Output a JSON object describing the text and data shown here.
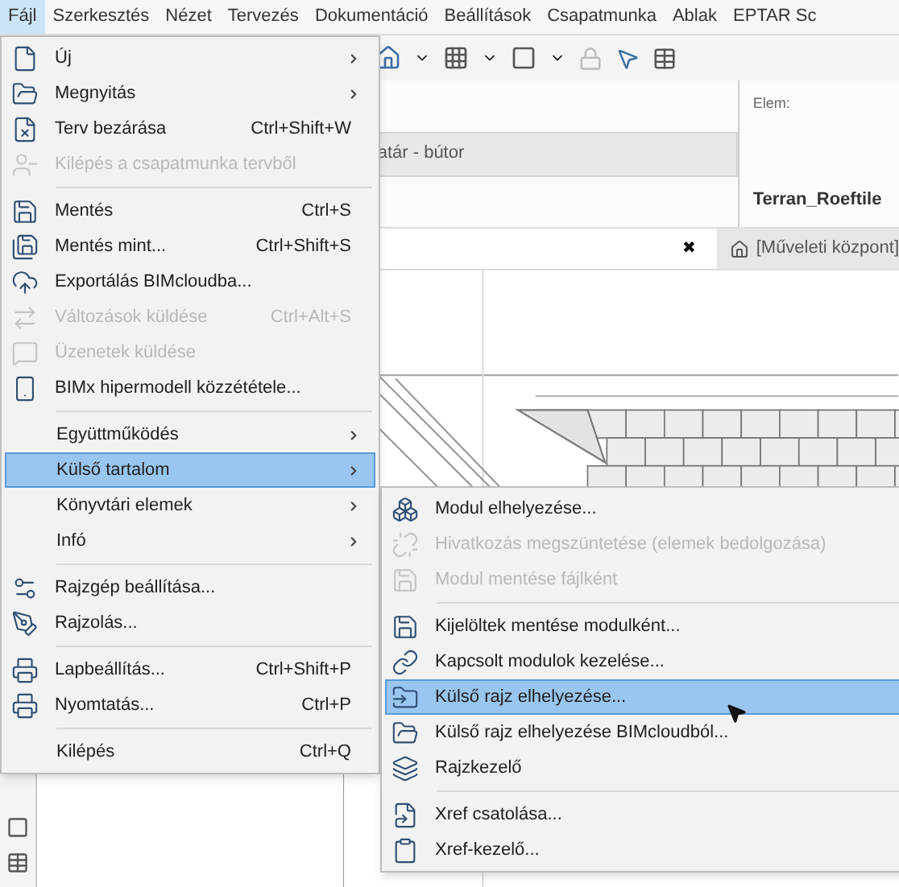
{
  "menubar": [
    {
      "label": "Fájl",
      "selected": true
    },
    {
      "label": "Szerkesztés",
      "selected": false
    },
    {
      "label": "Nézet",
      "selected": false
    },
    {
      "label": "Tervezés",
      "selected": false
    },
    {
      "label": "Dokumentáció",
      "selected": false
    },
    {
      "label": "Beállítások",
      "selected": false
    },
    {
      "label": "Csapatmunka",
      "selected": false
    },
    {
      "label": "Ablak",
      "selected": false
    },
    {
      "label": "EPTAR Sc",
      "selected": false
    }
  ],
  "info_panel": {
    "label": "Elem:",
    "value": "Terran_Roeftile",
    "layer_field": "atár - bútor",
    "tab": "[Műveleti központ]",
    "close": "✖"
  },
  "file_menu": [
    [
      {
        "label": "Új",
        "submenu": true,
        "disabled": false,
        "selected": false
      },
      {
        "label": "Megnyitás",
        "submenu": true,
        "disabled": false,
        "selected": false
      },
      {
        "label": "Terv bezárása",
        "shortcut": "Ctrl+Shift+W",
        "submenu": false,
        "disabled": false,
        "selected": false
      },
      {
        "label": "Kilépés a csapatmunka tervből",
        "submenu": false,
        "disabled": true,
        "selected": false
      }
    ],
    [
      {
        "label": "Mentés",
        "shortcut": "Ctrl+S",
        "submenu": false,
        "disabled": false,
        "selected": false
      },
      {
        "label": "Mentés mint...",
        "shortcut": "Ctrl+Shift+S",
        "submenu": false,
        "disabled": false,
        "selected": false
      },
      {
        "label": "Exportálás BIMcloudba...",
        "submenu": false,
        "disabled": false,
        "selected": false
      },
      {
        "label": "Változások küldése",
        "shortcut": "Ctrl+Alt+S",
        "submenu": false,
        "disabled": true,
        "selected": false
      },
      {
        "label": "Üzenetek küldése",
        "submenu": false,
        "disabled": true,
        "selected": false
      },
      {
        "label": "BIMx hipermodell közzététele...",
        "submenu": false,
        "disabled": false,
        "selected": false
      }
    ],
    [
      {
        "label": "Együttműködés",
        "submenu": true,
        "disabled": false,
        "selected": false
      },
      {
        "label": "Külső tartalom",
        "submenu": true,
        "disabled": false,
        "selected": true
      },
      {
        "label": "Könyvtári elemek",
        "submenu": true,
        "disabled": false,
        "selected": false
      },
      {
        "label": "Infó",
        "submenu": true,
        "disabled": false,
        "selected": false
      }
    ],
    [
      {
        "label": "Rajzgép beállítása...",
        "submenu": false,
        "disabled": false,
        "selected": false
      },
      {
        "label": "Rajzolás...",
        "submenu": false,
        "disabled": false,
        "selected": false
      }
    ],
    [
      {
        "label": "Lapbeállítás...",
        "shortcut": "Ctrl+Shift+P",
        "submenu": false,
        "disabled": false,
        "selected": false
      },
      {
        "label": "Nyomtatás...",
        "shortcut": "Ctrl+P",
        "submenu": false,
        "disabled": false,
        "selected": false
      }
    ],
    [
      {
        "label": "Kilépés",
        "shortcut": "Ctrl+Q",
        "submenu": false,
        "disabled": false,
        "selected": false
      }
    ]
  ],
  "submenu": [
    [
      {
        "label": "Modul elhelyezése...",
        "disabled": false,
        "selected": false
      },
      {
        "label": "Hivatkozás megszüntetése (elemek bedolgozása)",
        "disabled": true,
        "selected": false
      },
      {
        "label": "Modul mentése fájlként",
        "disabled": true,
        "selected": false
      }
    ],
    [
      {
        "label": "Kijelöltek mentése modulként...",
        "disabled": false,
        "selected": false
      },
      {
        "label": "Kapcsolt modulok kezelése...",
        "disabled": false,
        "selected": false
      },
      {
        "label": "Külső rajz elhelyezése...",
        "disabled": false,
        "selected": true
      },
      {
        "label": "Külső rajz elhelyezése BIMcloudból...",
        "disabled": false,
        "selected": false
      },
      {
        "label": "Rajzkezelő",
        "disabled": false,
        "selected": false
      }
    ],
    [
      {
        "label": "Xref csatolása...",
        "disabled": false,
        "selected": false
      },
      {
        "label": "Xref-kezelő...",
        "disabled": false,
        "selected": false
      }
    ]
  ]
}
